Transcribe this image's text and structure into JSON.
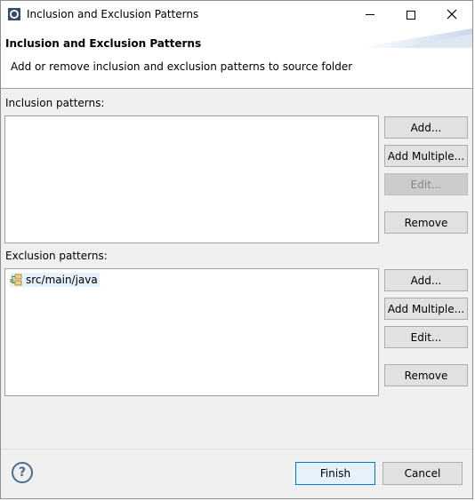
{
  "window": {
    "title": "Inclusion and Exclusion Patterns"
  },
  "header": {
    "title": "Inclusion and Exclusion Patterns",
    "description": "Add or remove inclusion and exclusion patterns to source folder"
  },
  "inclusion": {
    "label": "Inclusion patterns:",
    "items": [],
    "buttons": {
      "add": "Add...",
      "add_multiple": "Add Multiple...",
      "edit": "Edit...",
      "remove": "Remove"
    }
  },
  "exclusion": {
    "label": "Exclusion patterns:",
    "items": [
      {
        "label": "src/main/java",
        "icon": "package-folder-icon"
      }
    ],
    "buttons": {
      "add": "Add...",
      "add_multiple": "Add Multiple...",
      "edit": "Edit...",
      "remove": "Remove"
    }
  },
  "footer": {
    "help_icon": "?",
    "finish": "Finish",
    "cancel": "Cancel"
  },
  "colors": {
    "accent": "#0078d7",
    "dialog_bg": "#f0f0f0"
  }
}
